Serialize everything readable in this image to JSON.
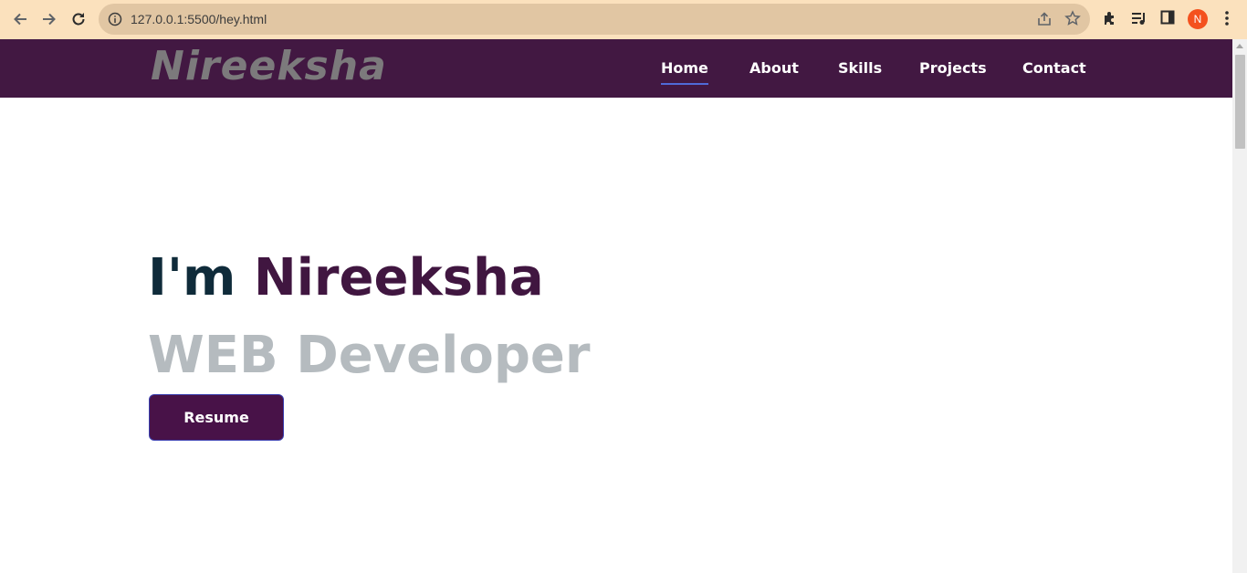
{
  "browser": {
    "url": "127.0.0.1:5500/hey.html",
    "profile_initial": "N",
    "icons": [
      "back-icon",
      "forward-icon",
      "reload-icon",
      "info-icon",
      "share-icon",
      "star-icon",
      "extensions-icon",
      "reading-list-icon",
      "side-panel-icon",
      "profile-avatar",
      "menu-icon"
    ]
  },
  "site": {
    "logo": "Nireeksha",
    "nav": [
      {
        "label": "Home",
        "active": true
      },
      {
        "label": "About",
        "active": false
      },
      {
        "label": "Skills",
        "active": false
      },
      {
        "label": "Projects",
        "active": false
      },
      {
        "label": "Contact",
        "active": false
      }
    ],
    "hero": {
      "intro": "I'm",
      "name": "Nireeksha",
      "role": "WEB Developer",
      "button": "Resume"
    }
  },
  "colors": {
    "header_bg": "#421842",
    "name_color": "#401640",
    "button_bg": "#481248",
    "active_underline": "#4f6bd8"
  }
}
